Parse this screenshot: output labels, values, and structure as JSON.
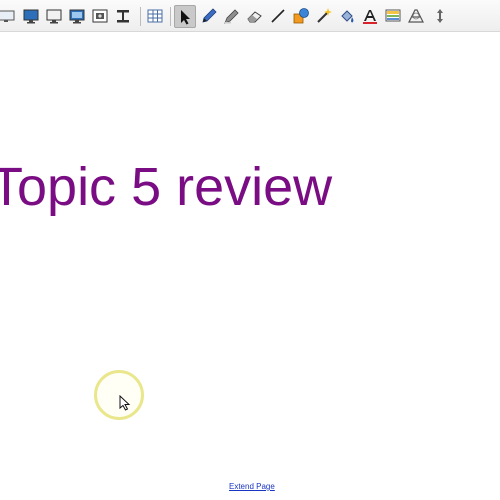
{
  "toolbar": {
    "icons": [
      "screen-icon",
      "monitor-icon",
      "monitor-blank-icon",
      "monitor-display-icon",
      "screen-capture-icon",
      "document-camera-icon",
      "table-icon",
      "select-arrow-icon",
      "pen-icon",
      "highlighter-icon",
      "eraser-icon",
      "line-icon",
      "shapes-icon",
      "magic-pen-icon",
      "fill-icon",
      "text-icon",
      "properties-icon",
      "capture-icon",
      "more-arrows-icon"
    ],
    "selected_tool": "select-arrow-icon"
  },
  "canvas": {
    "title": "Topic 5 review",
    "title_color": "#7a0c84",
    "extend_link": "Extend Page",
    "link_color": "#1a35c4",
    "cursor_highlight_color": "#e9e68c"
  }
}
